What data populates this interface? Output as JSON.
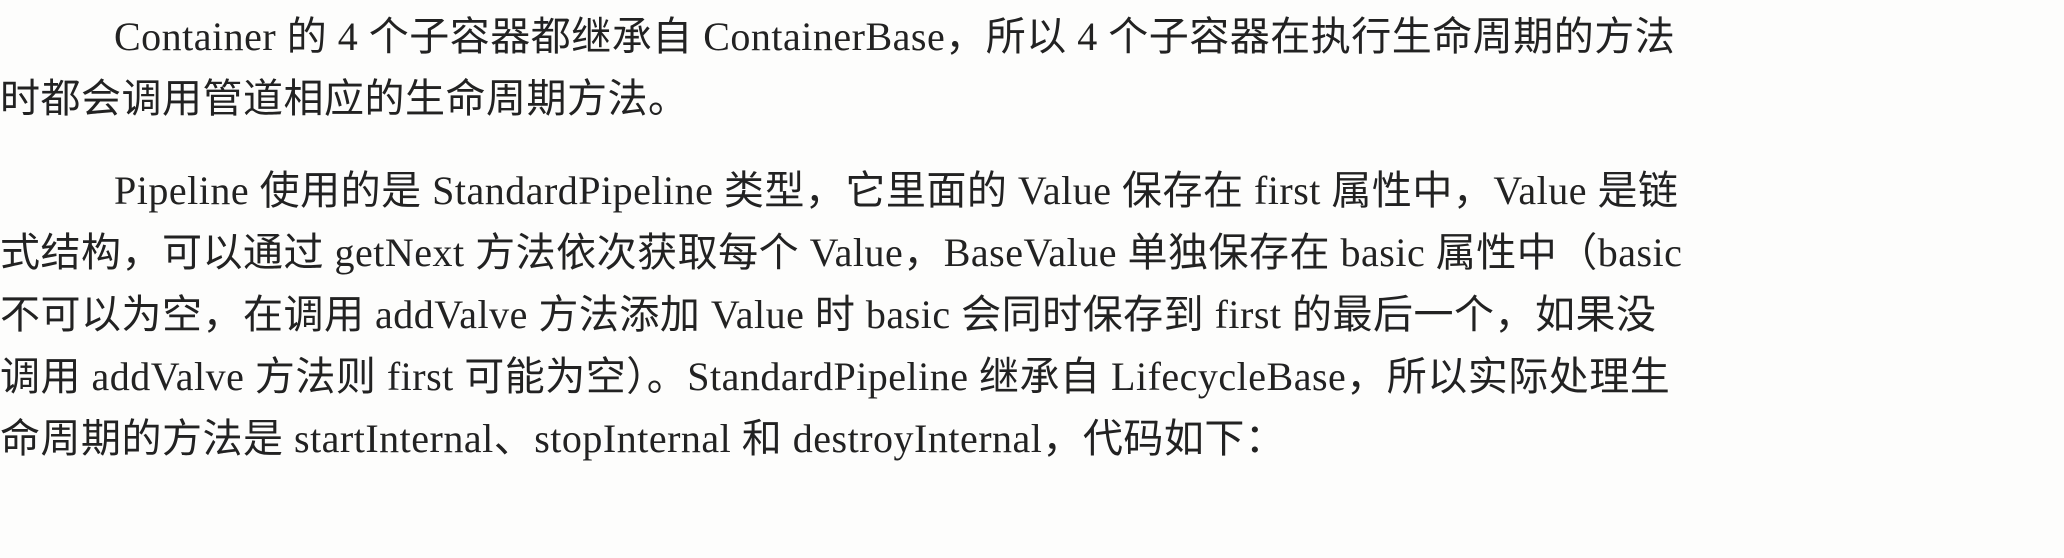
{
  "document": {
    "paragraphs": [
      {
        "lines": [
          "Container 的 4 个子容器都继承自 ContainerBase，所以 4 个子容器在执行生命周期的方法",
          "时都会调用管道相应的生命周期方法。"
        ]
      },
      {
        "lines": [
          "Pipeline 使用的是 StandardPipeline 类型，它里面的 Value 保存在 first 属性中，Value 是链",
          "式结构，可以通过 getNext 方法依次获取每个 Value，BaseValue 单独保存在 basic 属性中（basic",
          "不可以为空，在调用 addValve 方法添加 Value 时 basic 会同时保存到 first 的最后一个，如果没",
          "调用 addValve 方法则 first 可能为空）。StandardPipeline 继承自 LifecycleBase，所以实际处理生",
          "命周期的方法是 startInternal、stopInternal 和 destroyInternal，代码如下："
        ]
      }
    ]
  }
}
